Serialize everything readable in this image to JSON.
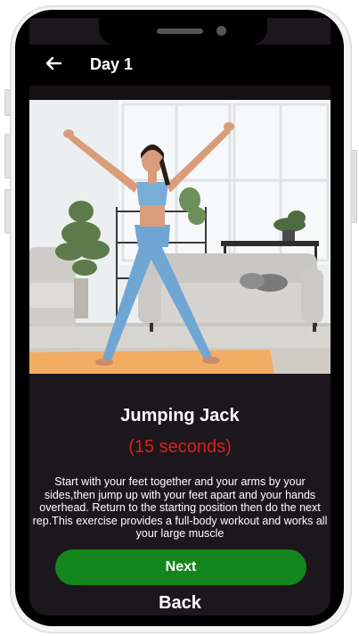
{
  "header": {
    "title": "Day 1",
    "back_icon": "arrow-left-icon"
  },
  "exercise": {
    "name": "Jumping Jack",
    "duration": "(15 seconds)",
    "description": "Start with your feet together and your arms by your sides,then jump up with your feet apart and your hands overhead. Return to the starting position then do the next rep.This exercise provides a full-body workout and works all your large muscle"
  },
  "actions": {
    "next_label": "Next",
    "back_label": "Back"
  },
  "colors": {
    "accent_green": "#15861d",
    "duration_red": "#d9211b",
    "screen_bg": "#1c171c"
  }
}
